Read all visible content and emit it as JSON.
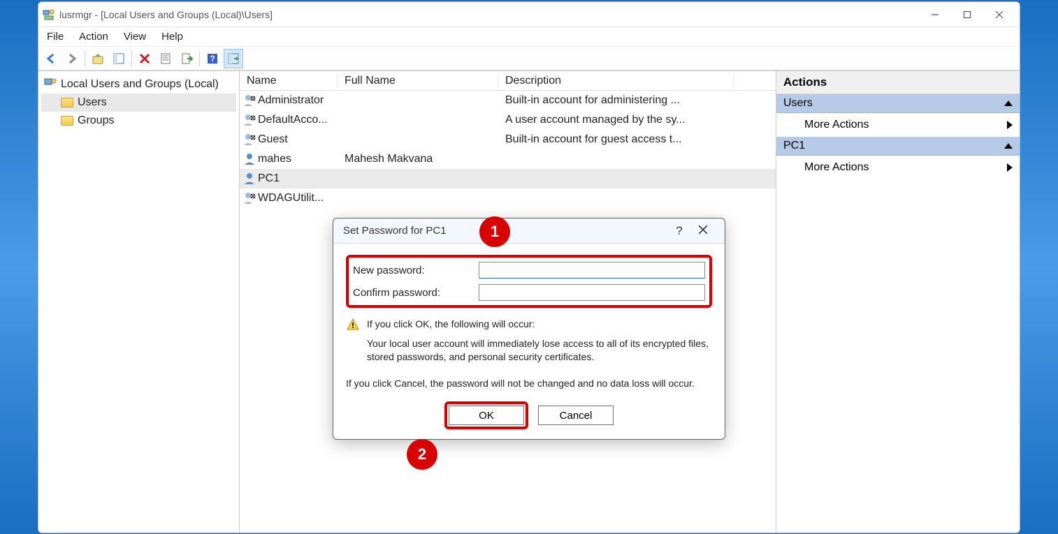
{
  "window": {
    "title": "lusrmgr - [Local Users and Groups (Local)\\Users]"
  },
  "menu": {
    "file": "File",
    "action": "Action",
    "view": "View",
    "help": "Help"
  },
  "tree": {
    "root": "Local Users and Groups (Local)",
    "users": "Users",
    "groups": "Groups"
  },
  "list": {
    "headers": {
      "name": "Name",
      "full": "Full Name",
      "desc": "Description"
    },
    "rows": [
      {
        "name": "Administrator",
        "full": "",
        "desc": "Built-in account for administering ..."
      },
      {
        "name": "DefaultAcco...",
        "full": "",
        "desc": "A user account managed by the sy..."
      },
      {
        "name": "Guest",
        "full": "",
        "desc": "Built-in account for guest access t..."
      },
      {
        "name": "mahes",
        "full": "Mahesh Makvana",
        "desc": ""
      },
      {
        "name": "PC1",
        "full": "",
        "desc": ""
      },
      {
        "name": "WDAGUtilit...",
        "full": "",
        "desc": ""
      }
    ]
  },
  "actions": {
    "title": "Actions",
    "section1": "Users",
    "more1": "More Actions",
    "section2": "PC1",
    "more2": "More Actions"
  },
  "dialog": {
    "title": "Set Password for PC1",
    "help": "?",
    "new_label": "New password:",
    "confirm_label": "Confirm password:",
    "warn_line1": "If you click OK, the following will occur:",
    "warn_line2": "Your local user account will immediately lose access to all of its encrypted files, stored passwords, and personal security certificates.",
    "warn_line3": "If you click Cancel, the password will not be changed and no data loss will occur.",
    "ok": "OK",
    "cancel": "Cancel"
  },
  "badges": {
    "b1": "1",
    "b2": "2"
  }
}
